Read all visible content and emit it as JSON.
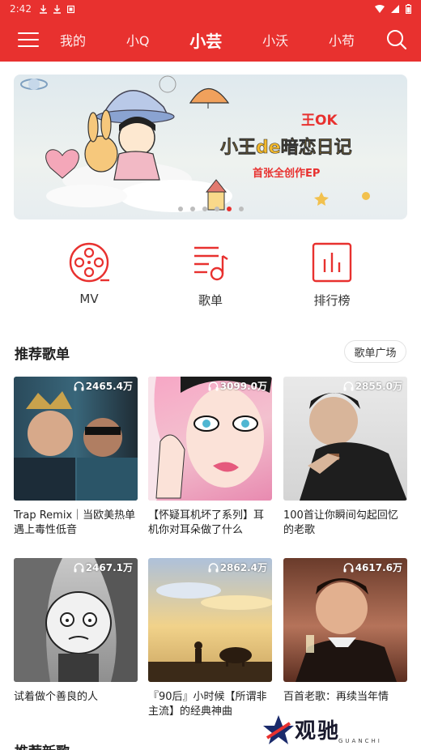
{
  "status_bar": {
    "time": "2:42"
  },
  "header": {
    "tabs": [
      {
        "label": "我的"
      },
      {
        "label": "小Q"
      },
      {
        "label": "小芸"
      },
      {
        "label": "小沃"
      },
      {
        "label": "小苟"
      }
    ],
    "active_tab": 2,
    "accent_color": "#e8312f"
  },
  "banner": {
    "art_text_line1": "王OK",
    "art_text_line2": "小王de暗恋日记",
    "art_text_line3": "首张全创作EP",
    "page_count": 6,
    "active_page": 4
  },
  "features": [
    {
      "label": "MV",
      "icon": "film-reel-icon"
    },
    {
      "label": "歌单",
      "icon": "playlist-icon"
    },
    {
      "label": "排行榜",
      "icon": "chart-icon"
    }
  ],
  "recommend": {
    "title": "推荐歌单",
    "more_label": "歌单广场",
    "playlists": [
      {
        "plays": "2465.4万",
        "title": "Trap Remix｜当欧美热单遇上毒性低音"
      },
      {
        "plays": "3099.0万",
        "title": "【怀疑耳机坏了系列】耳机你对耳朵做了什么"
      },
      {
        "plays": "2855.0万",
        "title": "100首让你瞬间勾起回忆的老歌"
      },
      {
        "plays": "2467.1万",
        "title": "试着做个善良的人"
      },
      {
        "plays": "2862.4万",
        "title": "『90后』小时候【所谓非主流】的经典神曲"
      },
      {
        "plays": "4617.6万",
        "title": "百首老歌：再续当年情"
      }
    ]
  },
  "next_section_title": "推荐新歌",
  "watermark": {
    "text": "观驰",
    "sub": "GUANCHI"
  }
}
